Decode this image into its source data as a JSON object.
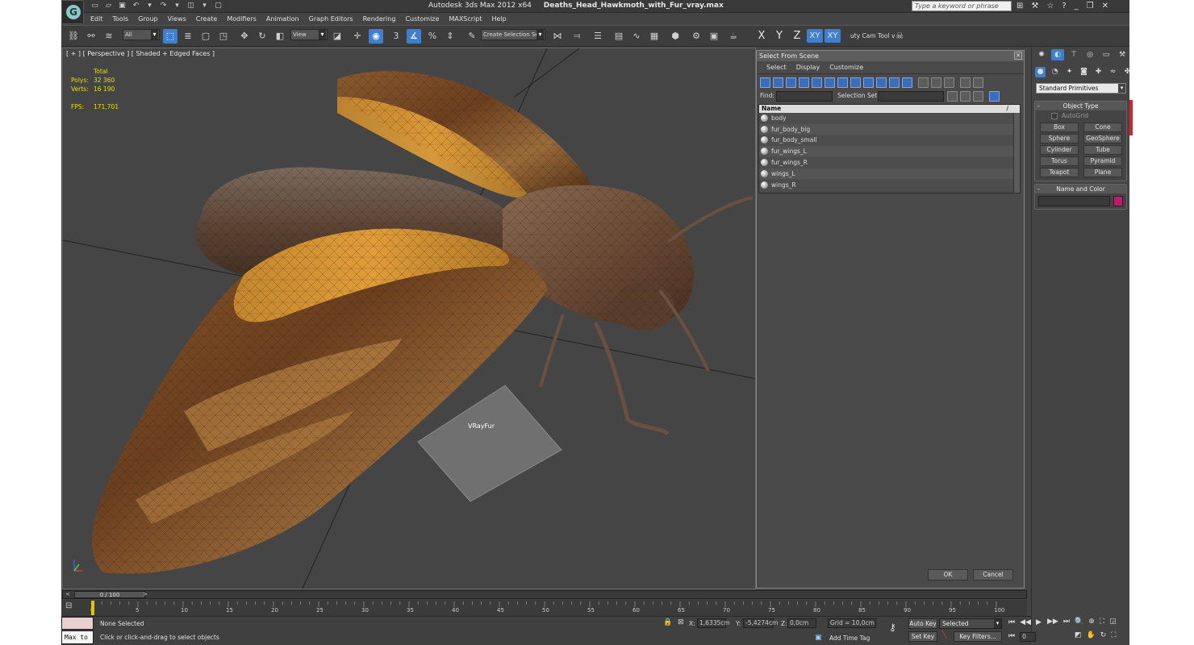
{
  "titlebar": {
    "app_title": "Autodesk 3ds Max  2012 x64",
    "file_title": "Deaths_Head_Hawkmoth_with_Fur_vray.max",
    "search_placeholder": "Type a keyword or phrase"
  },
  "menu": [
    "Edit",
    "Tools",
    "Group",
    "Views",
    "Create",
    "Modifiers",
    "Animation",
    "Graph Editors",
    "Rendering",
    "Customize",
    "MAXScript",
    "Help"
  ],
  "toolbar": {
    "selection_filter": "All",
    "ref_coord": "View",
    "selection_set": "Create Selection Se",
    "axis_x": "X",
    "axis_y": "Y",
    "axis_z": "Z",
    "axis_xy": "XY",
    "axis_xy2": "XY",
    "plugin_label": "uty Cam Tool v",
    "snap_label": "3",
    "percent_label": "%"
  },
  "viewport": {
    "label": "[ + ] [ Perspective ] [ Shaded + Edged Faces ]",
    "stats": {
      "total_label": "Total",
      "polys_label": "Polys:",
      "polys_value": "32 360",
      "verts_label": "Verts:",
      "verts_value": "16 190",
      "fps_label": "FPS:",
      "fps_value": "171,701"
    },
    "fur_label": "VRayFur"
  },
  "dialog": {
    "title": "Select From Scene",
    "menu": [
      "Select",
      "Display",
      "Customize"
    ],
    "find_label": "Find:",
    "selection_set_label": "Selection Set:",
    "column_name": "Name",
    "column_sort": "/",
    "objects": [
      "body",
      "fur_body_big",
      "fur_body_small",
      "fur_wings_L",
      "fur_wings_R",
      "wings_L",
      "wings_R"
    ],
    "ok_label": "OK",
    "cancel_label": "Cancel"
  },
  "command_panel": {
    "category": "Standard Primitives",
    "object_type_title": "Object Type",
    "autogrid_label": "AutoGrid",
    "primitives": [
      "Box",
      "Cone",
      "Sphere",
      "GeoSphere",
      "Cylinder",
      "Tube",
      "Torus",
      "Pyramid",
      "Teapot",
      "Plane"
    ],
    "name_color_title": "Name and Color",
    "color": "#c21a6b"
  },
  "timeline": {
    "frame_range": "0 / 100",
    "prev_arrow": "<",
    "next_arrow": ">",
    "ticks": [
      "0",
      "5",
      "10",
      "15",
      "20",
      "25",
      "30",
      "35",
      "40",
      "45",
      "50",
      "55",
      "60",
      "65",
      "70",
      "75",
      "80",
      "85",
      "90",
      "95",
      "100"
    ]
  },
  "status": {
    "maxscript_label": "Max to",
    "selection_status": "None Selected",
    "prompt": "Click or click-and-drag to select objects",
    "x_label": "X:",
    "x_value": "1,6335cm",
    "y_label": "Y:",
    "y_value": "-5,4274cm",
    "z_label": "Z:",
    "z_value": "0,0cm",
    "grid": "Grid = 10,0cm",
    "add_time_tag": "Add Time Tag",
    "auto_key": "Auto Key",
    "set_key": "Set Key",
    "key_mode": "Selected",
    "key_filters": "Key Filters...",
    "frame_value": "0"
  }
}
